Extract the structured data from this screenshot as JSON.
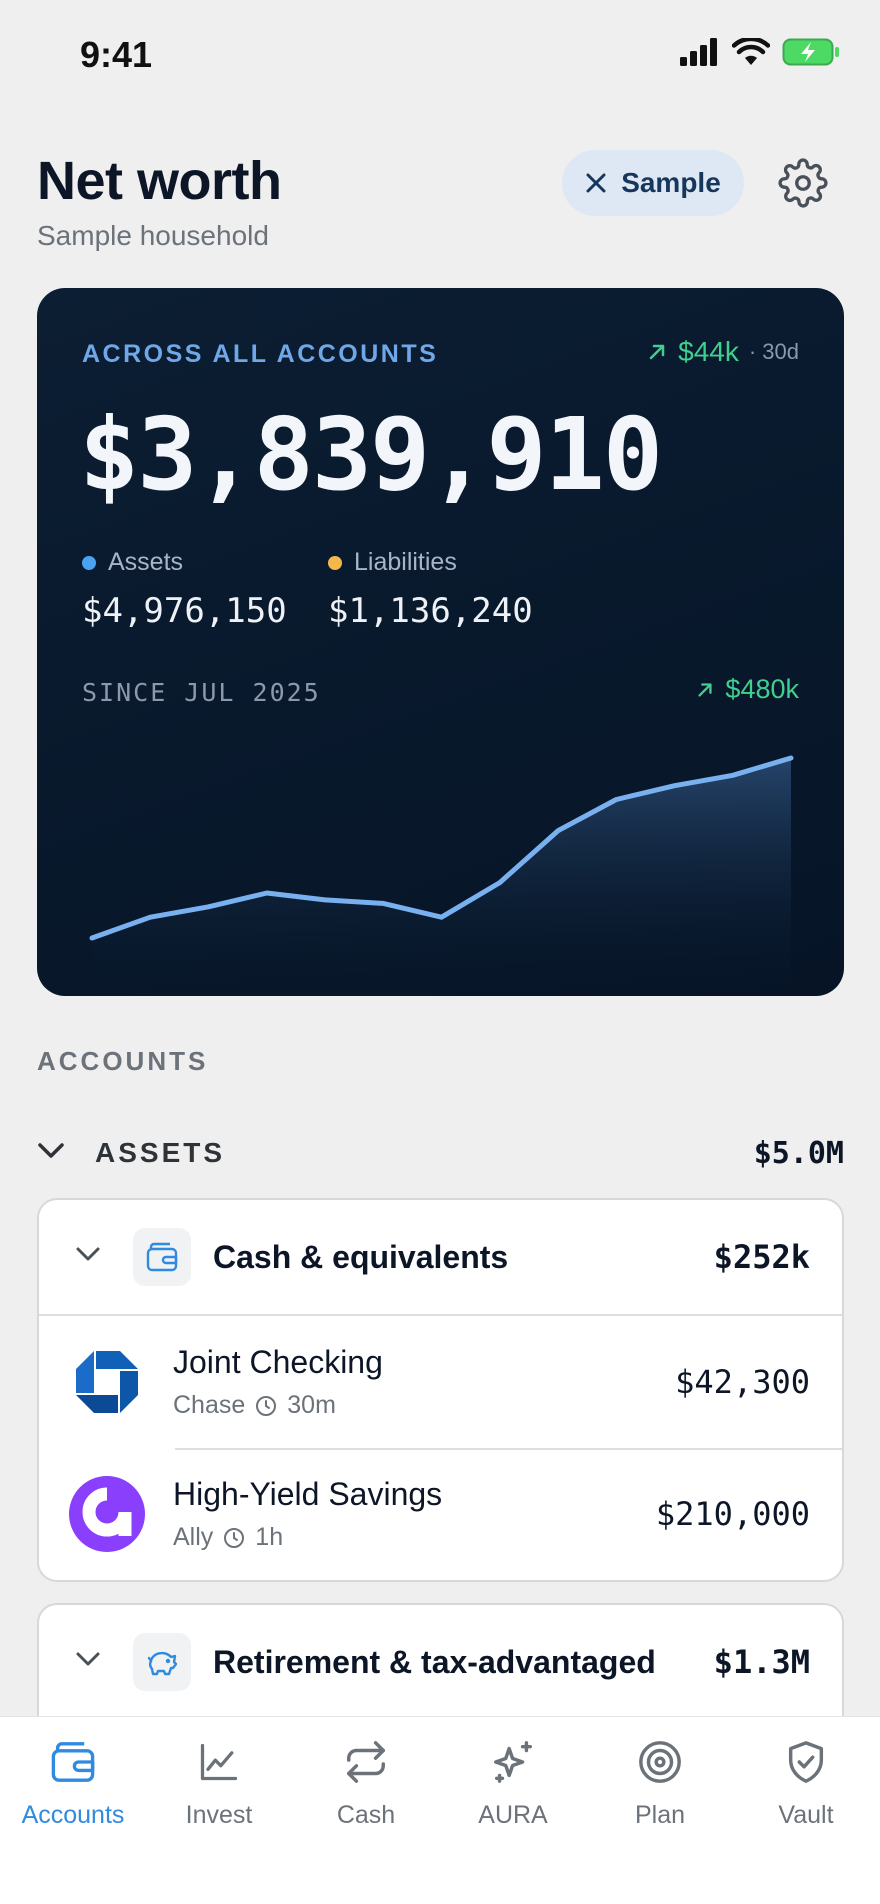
{
  "status_bar": {
    "time": "9:41"
  },
  "header": {
    "title": "Net worth",
    "subtitle": "Sample household",
    "sample_label": "Sample"
  },
  "hero": {
    "eyebrow": "ACROSS ALL ACCOUNTS",
    "delta_value": "$44k",
    "delta_period": "· 30d",
    "total": "$3,839,910",
    "assets_label": "Assets",
    "assets_value": "$4,976,150",
    "liabilities_label": "Liabilities",
    "liabilities_value": "$1,136,240",
    "since_label": "SINCE JUL 2025",
    "since_delta": "$480k",
    "colors": {
      "assets": "#4aa3f0",
      "liabilities": "#f2b84b",
      "positive": "#3fcf8e",
      "line": "#79b0ef"
    },
    "sparkline": [
      12,
      18,
      21,
      25,
      23,
      22,
      18,
      28,
      43,
      52,
      56,
      59,
      64
    ]
  },
  "accounts": {
    "section_label": "ACCOUNTS",
    "assets_label": "ASSETS",
    "assets_total": "$5.0M",
    "groups": [
      {
        "name": "Cash & equivalents",
        "amount": "$252k",
        "icon": "wallet-icon",
        "accounts": [
          {
            "name": "Joint Checking",
            "institution": "Chase",
            "synced": "30m",
            "amount": "$42,300",
            "logo": "chase-logo"
          },
          {
            "name": "High-Yield Savings",
            "institution": "Ally",
            "synced": "1h",
            "amount": "$210,000",
            "logo": "ally-logo"
          }
        ]
      },
      {
        "name": "Retirement & tax-advantaged",
        "amount": "$1.3M",
        "icon": "piggy-bank-icon",
        "accounts": []
      }
    ]
  },
  "tabs": [
    {
      "label": "Accounts",
      "icon": "wallet-icon",
      "active": true
    },
    {
      "label": "Invest",
      "icon": "chart-icon",
      "active": false
    },
    {
      "label": "Cash",
      "icon": "transfer-icon",
      "active": false
    },
    {
      "label": "AURA",
      "icon": "sparkle-icon",
      "active": false
    },
    {
      "label": "Plan",
      "icon": "target-icon",
      "active": false
    },
    {
      "label": "Vault",
      "icon": "shield-icon",
      "active": false
    }
  ]
}
